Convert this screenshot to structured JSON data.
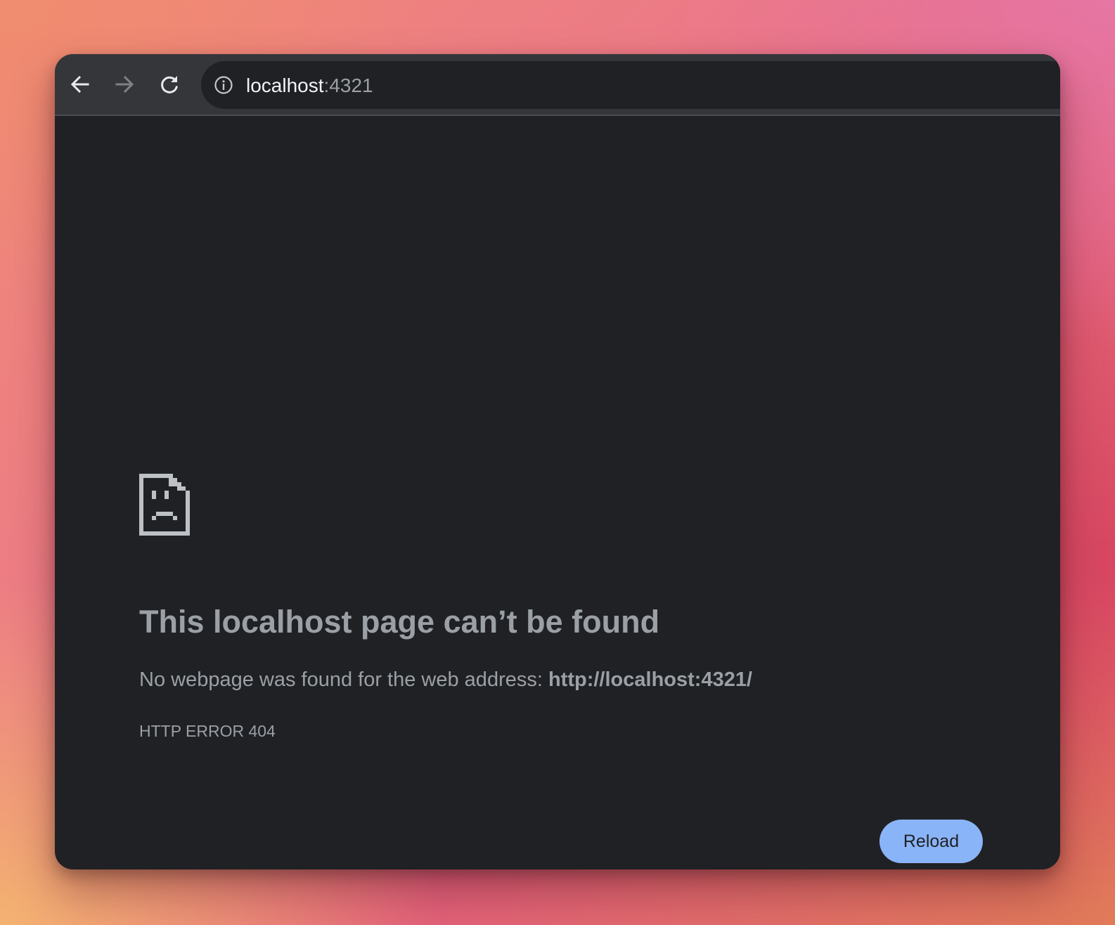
{
  "browser": {
    "toolbar": {
      "back_icon": "arrow-left-icon",
      "forward_icon": "arrow-right-icon",
      "reload_icon": "reload-icon",
      "site_info_icon": "info-icon"
    },
    "address_bar": {
      "host": "localhost",
      "port": ":4321"
    }
  },
  "error_page": {
    "icon": "sad-document-icon",
    "headline": "This localhost page can’t be found",
    "message_prefix": "No webpage was found for the web address: ",
    "message_url": "http://localhost:4321/",
    "error_code": "HTTP ERROR 404",
    "reload_label": "Reload"
  },
  "colors": {
    "window_background": "#202124",
    "toolbar_background": "#35363a",
    "text_secondary": "#9aa0a6",
    "button_accent": "#8ab4f8"
  }
}
